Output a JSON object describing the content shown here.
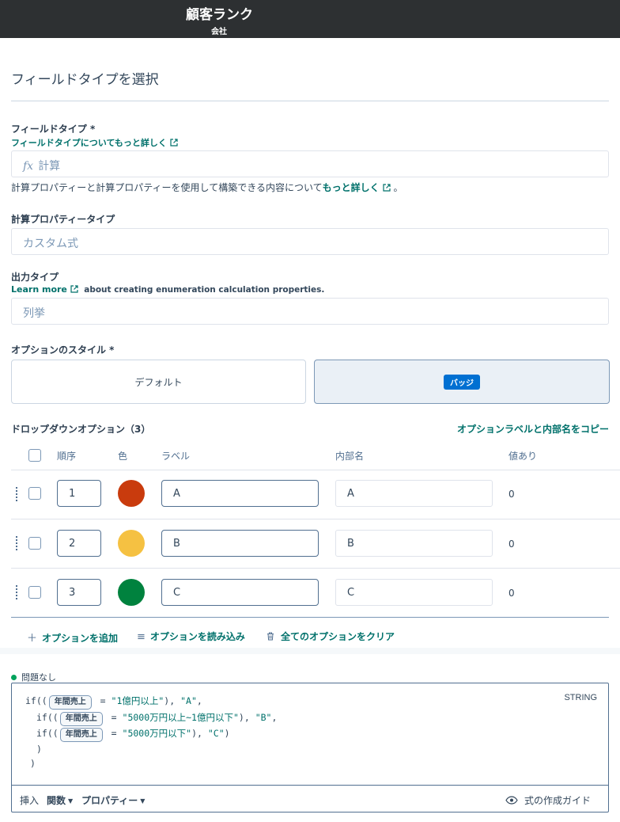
{
  "header": {
    "title": "顧客ランク",
    "subtitle": "会社"
  },
  "page": {
    "section_title": "フィールドタイプを選択"
  },
  "field_type": {
    "label": "フィールドタイプ *",
    "link": "フィールドタイプについてもっと詳しく",
    "value": "計算",
    "icon": "fx-icon",
    "help_text": "計算プロパティーと計算プロパティーを使用して構築できる内容について",
    "help_link": "もっと詳しく",
    "help_end": "。"
  },
  "calc_type": {
    "label": "計算プロパティータイプ",
    "value": "カスタム式"
  },
  "output_type": {
    "label": "出力タイプ",
    "link": "Learn more",
    "link_suffix": "about creating enumeration calculation properties.",
    "value": "列挙"
  },
  "option_style": {
    "label": "オプションのスタイル *",
    "default_label": "デフォルト",
    "badge_label": "バッジ",
    "selected": "バッジ"
  },
  "dropdown": {
    "title": "ドロップダウンオプション（3）",
    "copy_link": "オプションラベルと内部名をコピー",
    "columns": {
      "order": "順序",
      "color": "色",
      "label": "ラベル",
      "internal": "内部名",
      "has_value": "値あり"
    },
    "rows": [
      {
        "order": "1",
        "color": "#c93b0d",
        "label": "A",
        "internal": "A",
        "count": "0"
      },
      {
        "order": "2",
        "color": "#f5c142",
        "label": "B",
        "internal": "B",
        "count": "0"
      },
      {
        "order": "3",
        "color": "#00823e",
        "label": "C",
        "internal": "C",
        "count": "0"
      }
    ],
    "actions": {
      "add": "オプションを追加",
      "load": "オプションを読み込み",
      "clear": "全てのオプションをクリア"
    }
  },
  "formula": {
    "status": "問題なし",
    "return_type": "STRING",
    "token": "年間売上",
    "lines": [
      {
        "prefix": "if((",
        "eq": "=",
        "str": "\"1億円以上\"",
        "mid": "),",
        "str2": "\"A\"",
        "end": ","
      },
      {
        "prefix": "if((",
        "eq": "=",
        "str": "\"5000万円以上~1億円以下\"",
        "mid": "),",
        "str2": "\"B\"",
        "end": ","
      },
      {
        "prefix": "if((",
        "eq": "=",
        "str": "\"5000万円以下\"",
        "mid": "),",
        "str2": "\"C\"",
        "end": ")"
      }
    ],
    "close1": ")",
    "close2": ")",
    "toolbar": {
      "insert": "挿入",
      "functions": "関数",
      "properties": "プロパティー",
      "guide": "式の作成ガイド"
    }
  }
}
